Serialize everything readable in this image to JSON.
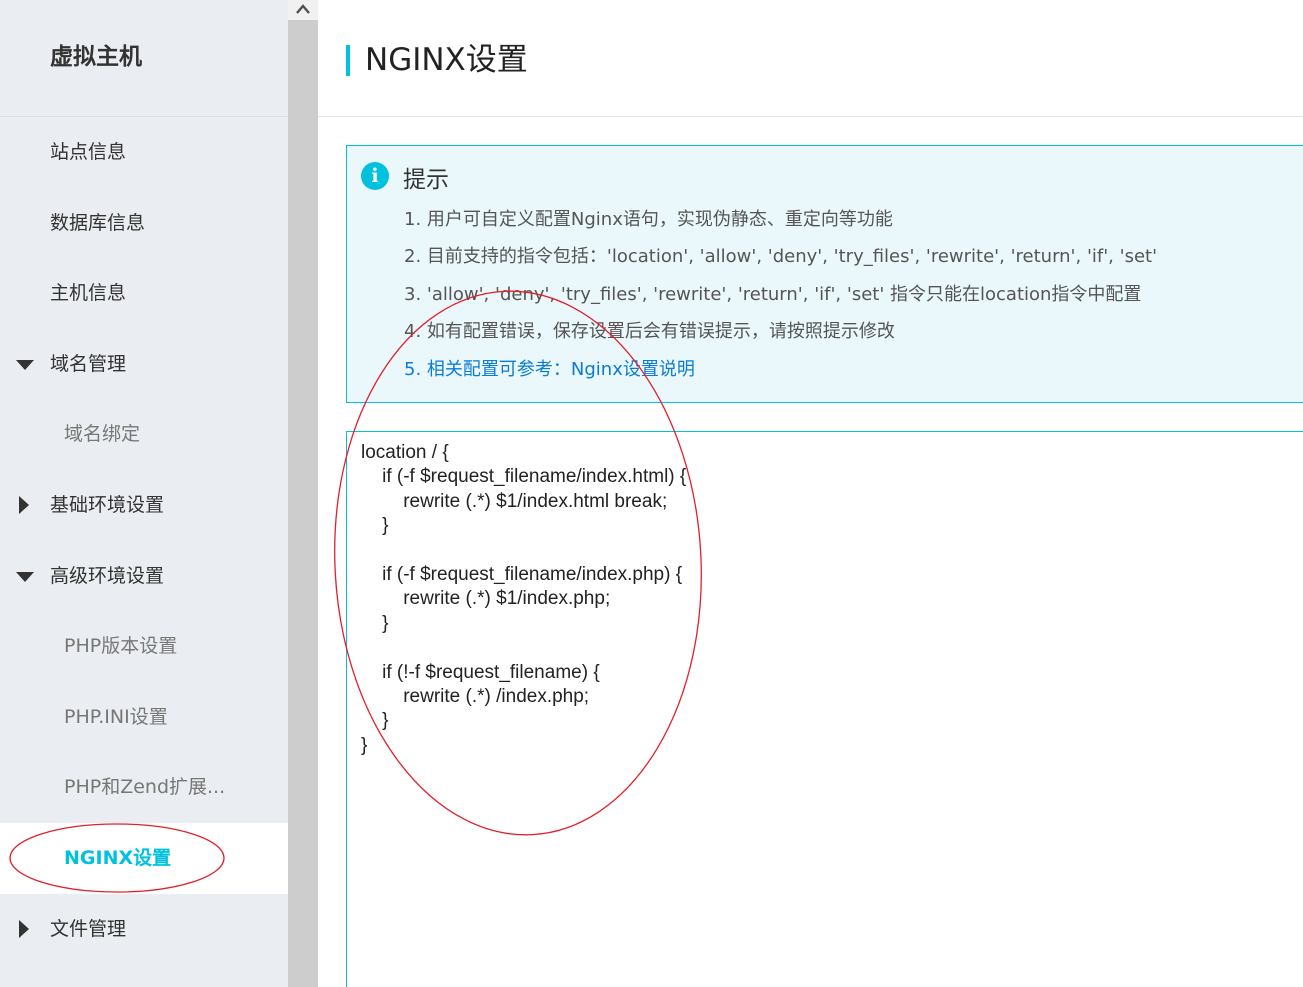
{
  "sidebar": {
    "title": "虚拟主机",
    "items": [
      {
        "label": "站点信息"
      },
      {
        "label": "数据库信息"
      },
      {
        "label": "主机信息"
      },
      {
        "label": "域名管理"
      },
      {
        "label": "域名绑定"
      },
      {
        "label": "基础环境设置"
      },
      {
        "label": "高级环境设置"
      },
      {
        "label": "PHP版本设置"
      },
      {
        "label": "PHP.INI设置"
      },
      {
        "label": "PHP和Zend扩展..."
      },
      {
        "label": "NGINX设置"
      },
      {
        "label": "文件管理"
      }
    ]
  },
  "header": {
    "title": "NGINX设置"
  },
  "tips": {
    "title": "提示",
    "icon": "i",
    "lines": [
      "1. 用户可自定义配置Nginx语句，实现伪静态、重定向等功能",
      "2. 目前支持的指令包括：'location', 'allow', 'deny', 'try_files', 'rewrite', 'return', 'if', 'set'",
      "3. 'allow', 'deny', 'try_files', 'rewrite', 'return', 'if', 'set' 指令只能在location指令中配置",
      "4. 如有配置错误，保存设置后会有错误提示，请按照提示修改",
      "5. 相关配置可参考：Nginx设置说明"
    ]
  },
  "editor": {
    "content": "location / {\n    if (-f $request_filename/index.html) {\n        rewrite (.*) $1/index.html break;\n    }\n\n    if (-f $request_filename/index.php) {\n        rewrite (.*) $1/index.php;\n    }\n\n    if (!-f $request_filename) {\n        rewrite (.*) /index.php;\n    }\n}"
  },
  "colors": {
    "accent": "#00c1de",
    "link": "#0b7cd6",
    "annotation": "#e0202a",
    "sidebar_bg": "#eaedf1"
  }
}
